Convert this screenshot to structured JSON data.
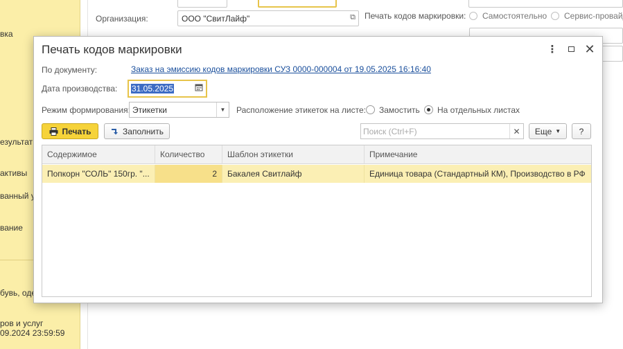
{
  "sidebar": {
    "items": [
      {
        "label": "вка"
      },
      {
        "label": "езультат"
      },
      {
        "label": "активы"
      },
      {
        "label": "ванный у"
      },
      {
        "label": "вание"
      },
      {
        "label": "бувь, оде"
      },
      {
        "label": "ров и услуг"
      },
      {
        "label": "09.2024 23:59:59"
      }
    ]
  },
  "background": {
    "org_label": "Организация:",
    "org_value": "ООО \"СвитЛайф\"",
    "print_codes_label": "Печать кодов маркировки:",
    "radio_self": "Самостоятельно",
    "radio_service": "Сервис-провайд"
  },
  "dialog": {
    "title": "Печать кодов маркировки",
    "doc_label": "По документу:",
    "doc_link": "Заказ на эмиссию кодов маркировки СУЗ 0000-000004 от 19.05.2025 16:16:40",
    "date_label": "Дата производства:",
    "date_value": "31.05.2025",
    "mode_label": "Режим формирования:",
    "mode_value": "Этикетки",
    "layout_label": "Расположение этикеток на листе:",
    "layout_opt1": "Замостить",
    "layout_opt2": "На отдельных листах",
    "layout_selected": "На отдельных листах",
    "print_button": "Печать",
    "fill_button": "Заполнить",
    "search_placeholder": "Поиск (Ctrl+F)",
    "more_button": "Еще",
    "help_button": "?",
    "table": {
      "columns": [
        "Содержимое",
        "Количество",
        "Шаблон этикетки",
        "Примечание"
      ],
      "rows": [
        [
          "Попкорн \"СОЛЬ\" 150гр. \"...",
          "2",
          "Бакалея Свитлайф",
          "Единица товара (Стандартный КМ), Производство в РФ"
        ]
      ]
    }
  },
  "colors": {
    "accent_yellow": "#f6d33a",
    "link_blue": "#1a4f9c",
    "selection_row": "#fbefb4",
    "sidebar_bg": "#fbeea8"
  }
}
